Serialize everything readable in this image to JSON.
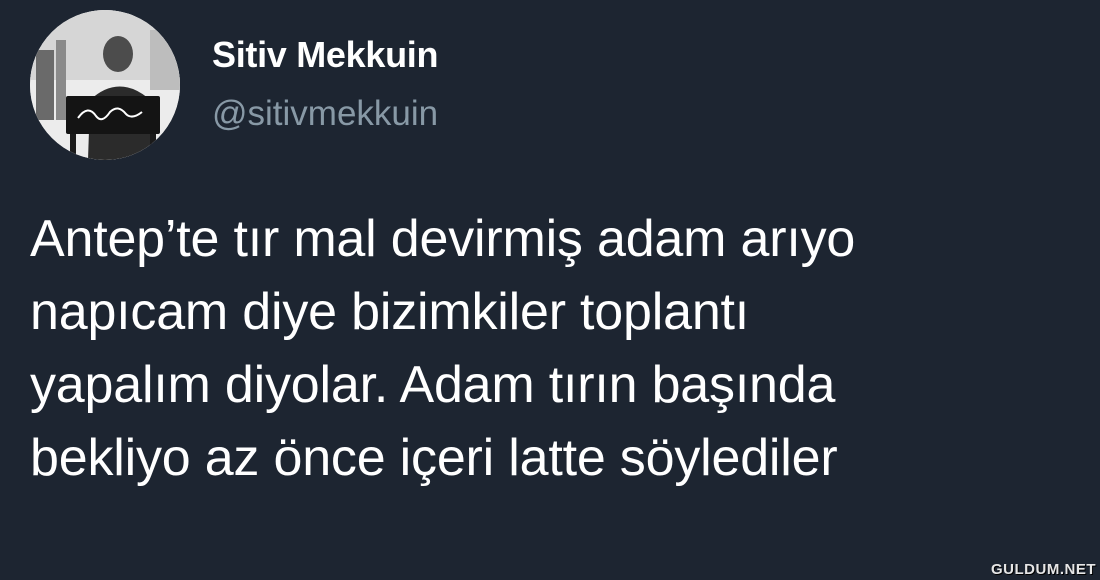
{
  "tweet": {
    "display_name": "Sitiv Mekkuin",
    "handle": "@sitivmekkuin",
    "avatar_icon": "profile-photo-icon",
    "text_lines": [
      "Antep’te tır mal devirmiş adam arıyo",
      "napıcam diye bizimkiler toplantı",
      "yapalım diyolar. Adam tırın başında",
      "bekliyo az önce içeri latte söylediler"
    ]
  },
  "watermark": "GULDUM.NET",
  "colors": {
    "background": "#1d2531",
    "text": "#ffffff",
    "handle": "#8899a6"
  }
}
